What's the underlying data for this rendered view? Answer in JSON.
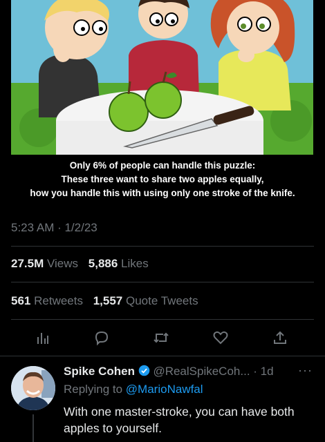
{
  "image": {
    "caption_lines": [
      "Only 6% of people can handle this puzzle:",
      "These three want to share two apples equally,",
      "how you handle this with using only one stroke of the knife."
    ]
  },
  "tweet": {
    "timestamp": "5:23 AM · 1/2/23",
    "views_count": "27.5M",
    "views_label": "Views",
    "likes_count": "5,886",
    "likes_label": "Likes",
    "retweets_count": "561",
    "retweets_label": "Retweets",
    "quotes_count": "1,557",
    "quotes_label": "Quote Tweets"
  },
  "actions": [
    "analytics-icon",
    "reply-icon",
    "retweet-icon",
    "like-icon",
    "share-icon"
  ],
  "reply": {
    "name": "Spike Cohen",
    "handle": "@RealSpikeCoh...",
    "time": "· 1d",
    "more": "···",
    "replying_prefix": "Replying to",
    "replying_to": "@MarioNawfal",
    "text": "With one master-stroke, you can have both apples to yourself."
  },
  "colors": {
    "accent": "#1d9bf0",
    "verified": "#1d9bf0",
    "muted": "#71767b",
    "text": "#e7e9ea",
    "background": "#000000"
  }
}
